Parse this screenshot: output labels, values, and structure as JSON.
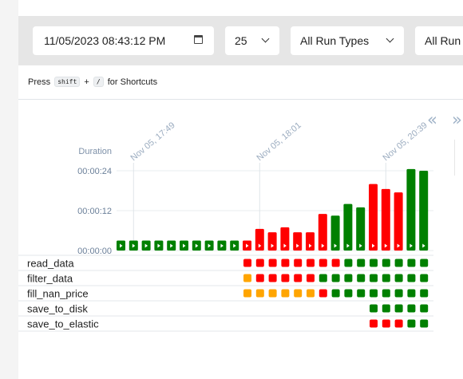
{
  "toolbar": {
    "date_value": "11/05/2023 08:43:12 PM",
    "num_runs": "25",
    "run_type": "All Run Types",
    "run_state": "All Run States"
  },
  "shortcuts": {
    "prefix": "Press",
    "key1": "shift",
    "plus": "+",
    "key2": "/",
    "suffix": "for Shortcuts"
  },
  "grid": {
    "duration_label": "Duration",
    "y_ticks": [
      "00:00:24",
      "00:00:12",
      "00:00:00"
    ],
    "date_markers": [
      {
        "label": "Nov 05, 17:49",
        "run_index": 1
      },
      {
        "label": "Nov 05, 18:01",
        "run_index": 11
      },
      {
        "label": "Nov 05, 20:39",
        "run_index": 21
      }
    ],
    "colors": {
      "success": "#008000",
      "failed": "#ff0000",
      "upstream_failed": "#ffa500"
    },
    "chart_data": {
      "type": "bar",
      "ylabel": "Duration",
      "ylim_seconds": [
        0,
        28
      ],
      "runs": [
        {
          "duration": 3,
          "state": "success"
        },
        {
          "duration": 3,
          "state": "success"
        },
        {
          "duration": 3,
          "state": "success"
        },
        {
          "duration": 3,
          "state": "success"
        },
        {
          "duration": 3,
          "state": "success"
        },
        {
          "duration": 3,
          "state": "success"
        },
        {
          "duration": 3,
          "state": "success"
        },
        {
          "duration": 3,
          "state": "success"
        },
        {
          "duration": 3,
          "state": "success"
        },
        {
          "duration": 3,
          "state": "success"
        },
        {
          "duration": 3,
          "state": "failed"
        },
        {
          "duration": 6.5,
          "state": "failed"
        },
        {
          "duration": 5.5,
          "state": "failed"
        },
        {
          "duration": 7,
          "state": "failed"
        },
        {
          "duration": 5.5,
          "state": "failed"
        },
        {
          "duration": 5.5,
          "state": "failed"
        },
        {
          "duration": 11,
          "state": "failed"
        },
        {
          "duration": 10.5,
          "state": "success"
        },
        {
          "duration": 14,
          "state": "success"
        },
        {
          "duration": 13,
          "state": "success"
        },
        {
          "duration": 20,
          "state": "failed"
        },
        {
          "duration": 18.5,
          "state": "failed"
        },
        {
          "duration": 17.5,
          "state": "failed"
        },
        {
          "duration": 24.5,
          "state": "success"
        },
        {
          "duration": 24,
          "state": "success"
        }
      ]
    },
    "tasks": [
      {
        "name": "read_data",
        "states": [
          null,
          null,
          null,
          null,
          null,
          null,
          null,
          null,
          null,
          null,
          "failed",
          "failed",
          "failed",
          "failed",
          "failed",
          "failed",
          "failed",
          "failed",
          "success",
          "success",
          "success",
          "success",
          "success",
          "success",
          "success"
        ]
      },
      {
        "name": "filter_data",
        "states": [
          null,
          null,
          null,
          null,
          null,
          null,
          null,
          null,
          null,
          null,
          "upstream_failed",
          "failed",
          "failed",
          "failed",
          "failed",
          "failed",
          "success",
          "success",
          "success",
          "success",
          "success",
          "success",
          "success",
          "success",
          "success"
        ]
      },
      {
        "name": "fill_nan_price",
        "states": [
          null,
          null,
          null,
          null,
          null,
          null,
          null,
          null,
          null,
          null,
          "upstream_failed",
          "upstream_failed",
          "upstream_failed",
          "upstream_failed",
          "upstream_failed",
          "upstream_failed",
          "failed",
          "success",
          "success",
          "success",
          "success",
          "success",
          "success",
          "success",
          "success"
        ]
      },
      {
        "name": "save_to_disk",
        "states": [
          null,
          null,
          null,
          null,
          null,
          null,
          null,
          null,
          null,
          null,
          null,
          null,
          null,
          null,
          null,
          null,
          null,
          null,
          null,
          null,
          "success",
          "success",
          "success",
          "success",
          "success"
        ]
      },
      {
        "name": "save_to_elastic",
        "states": [
          null,
          null,
          null,
          null,
          null,
          null,
          null,
          null,
          null,
          null,
          null,
          null,
          null,
          null,
          null,
          null,
          null,
          null,
          null,
          null,
          "failed",
          "failed",
          "failed",
          "success",
          "success"
        ]
      }
    ]
  }
}
